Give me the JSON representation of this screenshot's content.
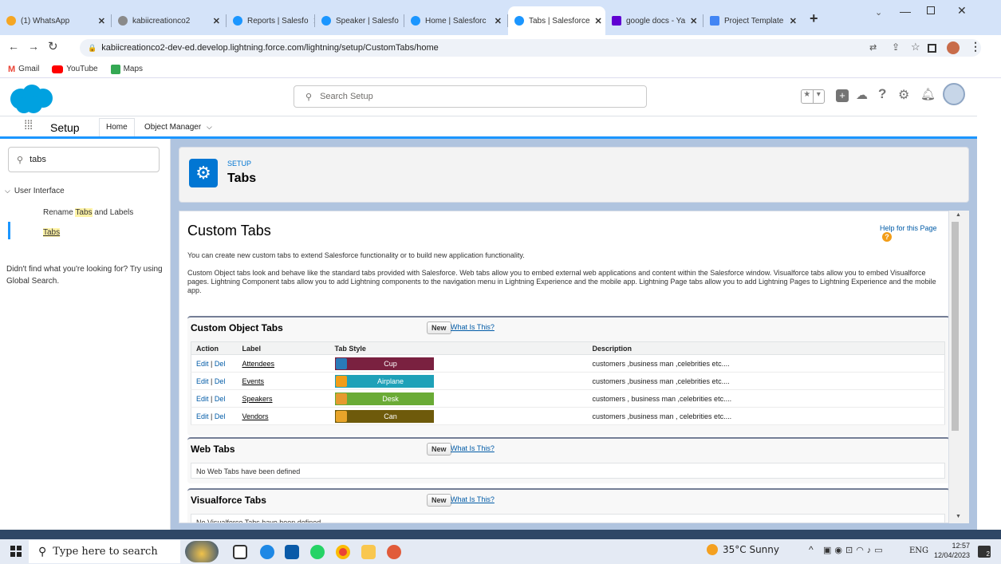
{
  "browser": {
    "tabs": [
      {
        "label": "(1) WhatsApp",
        "color": "#25d366",
        "active": false
      },
      {
        "label": "kabiicreationco2",
        "color": "#8a8a8a",
        "active": false
      },
      {
        "label": "Reports | Salesfo",
        "color": "#1b96ff",
        "active": false
      },
      {
        "label": "Speaker | Salesfo",
        "color": "#1b96ff",
        "active": false
      },
      {
        "label": "Home | Salesforc",
        "color": "#1b96ff",
        "active": false
      },
      {
        "label": "Tabs | Salesforce",
        "color": "#1b96ff",
        "active": true
      },
      {
        "label": "google docs - Ya",
        "color": "#6001d2",
        "active": false
      },
      {
        "label": "Project Template",
        "color": "#4285f4",
        "active": false
      }
    ],
    "url": "kabiicreationco2-dev-ed.develop.lightning.force.com/lightning/setup/CustomTabs/home",
    "bookmarks": [
      "Gmail",
      "YouTube",
      "Maps"
    ]
  },
  "sf": {
    "search_placeholder": "Search Setup",
    "app_name": "Setup",
    "nav_home": "Home",
    "nav_object_manager": "Object Manager"
  },
  "left": {
    "quickfind_value": "tabs",
    "group_label": "User Interface",
    "item1_pre": "Rename ",
    "item1_hl": "Tabs",
    "item1_post": " and Labels",
    "item2": "Tabs",
    "not_found": "Didn't find what you're looking for? Try using Global Search."
  },
  "page": {
    "eyebrow": "SETUP",
    "title": "Tabs",
    "content_title": "Custom Tabs",
    "help_link": "Help for this Page",
    "intro": "You can create new custom tabs to extend Salesforce functionality or to build new application functionality.",
    "description": "Custom Object tabs look and behave like the standard tabs provided with Salesforce. Web tabs allow you to embed external web applications and content within the Salesforce window. Visualforce tabs allow you to embed Visualforce pages. Lightning Component tabs allow you to add Lightning components to the navigation menu in Lightning Experience and the mobile app. Lightning Page tabs allow you to add Lightning Pages to Lightning Experience and the mobile app."
  },
  "custom_object_tabs": {
    "title": "Custom Object Tabs",
    "new_label": "New",
    "what_is_this": "What Is This?",
    "headers": [
      "Action",
      "Label",
      "Tab Style",
      "Description"
    ],
    "edit_label": "Edit",
    "del_label": "Del",
    "rows": [
      {
        "label": "Attendees",
        "style": "Cup",
        "style_color": "#7a2140",
        "icon_color": "#2a7ab8",
        "description": "customers ,business man ,celebrities etc...."
      },
      {
        "label": "Events",
        "style": "Airplane",
        "style_color": "#1fa1b8",
        "icon_color": "#f29d18",
        "description": "customers ,business man ,celebrities etc...."
      },
      {
        "label": "Speakers",
        "style": "Desk",
        "style_color": "#6aab36",
        "icon_color": "#e59a2e",
        "description": "customers , business man ,celebrities etc...."
      },
      {
        "label": "Vendors",
        "style": "Can",
        "style_color": "#6e5a0b",
        "icon_color": "#e8a42a",
        "description": "customers ,business man , celebrities etc...."
      }
    ]
  },
  "web_tabs": {
    "title": "Web Tabs",
    "new_label": "New",
    "what_is_this": "What Is This?",
    "empty": "No Web Tabs have been defined"
  },
  "visualforce_tabs": {
    "title": "Visualforce Tabs",
    "new_label": "New",
    "what_is_this": "What Is This?",
    "empty": "No Visualforce Tabs have been defined"
  },
  "taskbar": {
    "search_placeholder": "Type here to search",
    "weather": "35°C  Sunny",
    "lang": "ENG",
    "time": "12:57",
    "date": "12/04/2023",
    "notif_count": "2"
  }
}
